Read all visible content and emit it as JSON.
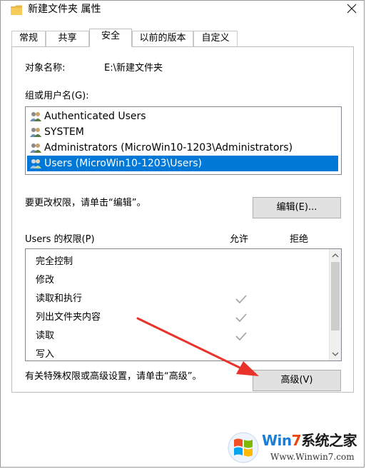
{
  "window": {
    "title": "新建文件夹 属性"
  },
  "tabs": [
    {
      "label": "常规",
      "active": false
    },
    {
      "label": "共享",
      "active": false
    },
    {
      "label": "安全",
      "active": true
    },
    {
      "label": "以前的版本",
      "active": false
    },
    {
      "label": "自定义",
      "active": false
    }
  ],
  "security": {
    "object_label": "对象名称:",
    "object_value": "E:\\新建文件夹",
    "group_label": "组或用户名(G):",
    "groups": [
      {
        "name": "Authenticated Users",
        "selected": false
      },
      {
        "name": "SYSTEM",
        "selected": false
      },
      {
        "name": "Administrators (MicroWin10-1203\\Administrators)",
        "selected": false
      },
      {
        "name": "Users (MicroWin10-1203\\Users)",
        "selected": true
      }
    ],
    "edit_hint": "要更改权限，请单击“编辑”。",
    "edit_button": "编辑(E)...",
    "perm_title": "Users 的权限(P)",
    "allow_header": "允许",
    "deny_header": "拒绝",
    "permissions": [
      {
        "name": "完全控制",
        "allow": false,
        "deny": false
      },
      {
        "name": "修改",
        "allow": false,
        "deny": false
      },
      {
        "name": "读取和执行",
        "allow": true,
        "deny": false
      },
      {
        "name": "列出文件夹内容",
        "allow": true,
        "deny": false
      },
      {
        "name": "读取",
        "allow": true,
        "deny": false
      },
      {
        "name": "写入",
        "allow": false,
        "deny": false
      }
    ],
    "advanced_hint": "有关特殊权限或高级设置，请单击“高级”。",
    "advanced_button": "高级(V)"
  },
  "icons": {
    "folder": "folder-icon",
    "close": "close-icon",
    "user_group": "user-group-icon",
    "check": "checkmark-icon",
    "scroll_up": "chevron-up-icon",
    "scroll_down": "chevron-down-icon"
  },
  "colors": {
    "selection": "#0078d7",
    "annotation_arrow": "#e8322a",
    "check_gray": "#a0a0a0"
  },
  "watermark": {
    "brand_part1": "Win",
    "brand_part2": "7",
    "brand_part3": "系统之家",
    "url": "Www.Winwin7.com"
  }
}
